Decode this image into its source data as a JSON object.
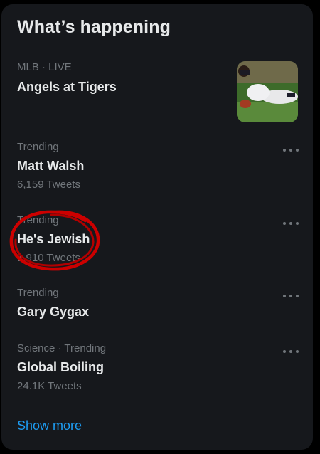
{
  "widget": {
    "title": "What’s happening",
    "show_more": "Show more"
  },
  "trends": [
    {
      "meta": "MLB · LIVE",
      "name": "Angels at Tigers",
      "count": "",
      "has_image": true
    },
    {
      "meta": "Trending",
      "name": "Matt Walsh",
      "count": "6,159 Tweets"
    },
    {
      "meta": "Trending",
      "name": "He's Jewish",
      "count": "1,910 Tweets",
      "circled": true
    },
    {
      "meta": "Trending",
      "name": "Gary Gygax",
      "count": ""
    },
    {
      "meta": "Science · Trending",
      "name": "Global Boiling",
      "count": "24.1K Tweets"
    }
  ],
  "icons": {
    "more": "more-horizontal-icon"
  },
  "colors": {
    "background": "#000000",
    "panel": "#16181c",
    "primary_text": "#e7e9ea",
    "secondary_text": "#71767b",
    "link": "#1d9bf0",
    "annotation": "#cc0000"
  }
}
